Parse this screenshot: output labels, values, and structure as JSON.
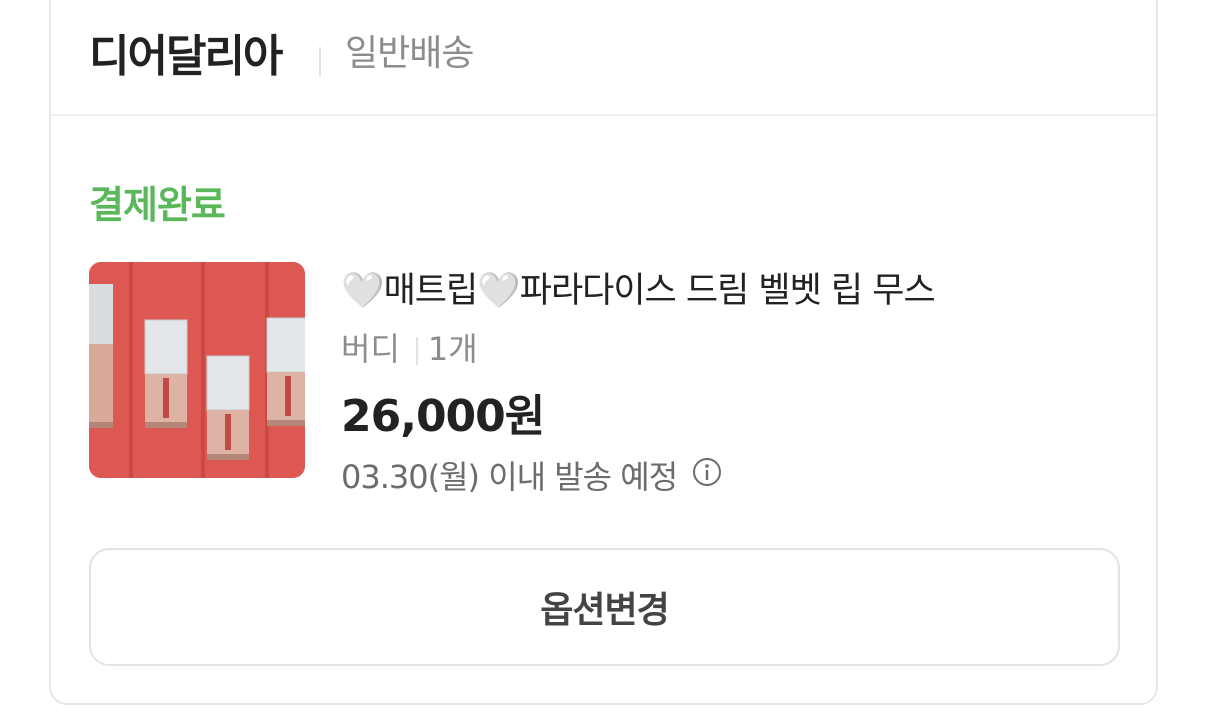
{
  "seller": {
    "name": "디어달리아",
    "shipping_type": "일반배송"
  },
  "order": {
    "status": "결제완료",
    "status_color": "#5ab85a",
    "product": {
      "title": "🤍매트립🤍파라다이스 드림 벨벳 립 무스",
      "option": "버디",
      "quantity": "1개",
      "price": "26,000원",
      "ship_date": "03.30(월) 이내 발송 예정",
      "image_icon": "lip-mousse-product-photo"
    }
  },
  "actions": {
    "change_option_label": "옵션변경"
  }
}
